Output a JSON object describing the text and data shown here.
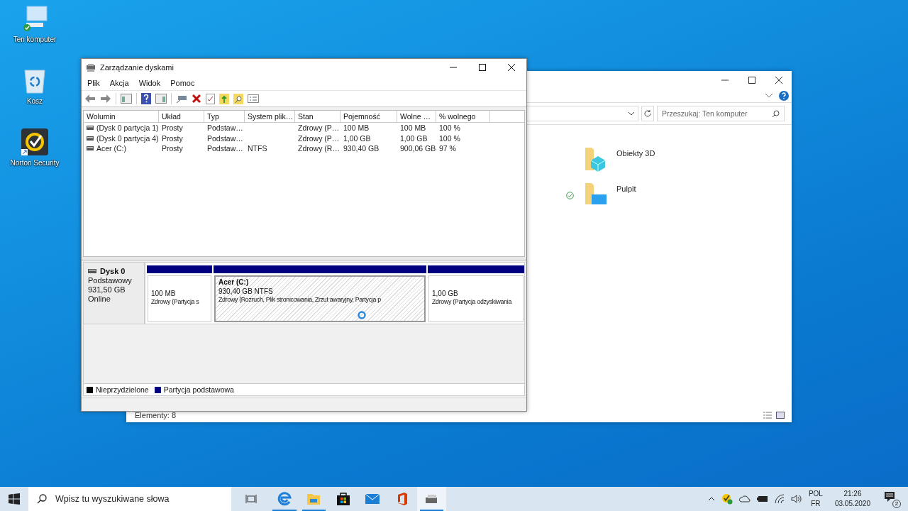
{
  "desktop_icons": [
    {
      "kind": "computer",
      "label": "Ten komputer"
    },
    {
      "kind": "recycle",
      "label": "Kosz"
    },
    {
      "kind": "norton",
      "label": "Norton Security"
    }
  ],
  "explorer": {
    "search": {
      "placeholder": "Przeszukaj: Ten komputer"
    },
    "items": [
      {
        "kind": "objects",
        "label": "Obiekty 3D",
        "synced": false
      },
      {
        "kind": "desktop",
        "label": "Pulpit",
        "synced": true
      }
    ],
    "status_bar": "Elementy: 8"
  },
  "disk_management": {
    "title": "Zarządzanie dyskami",
    "menu": [
      "Plik",
      "Akcja",
      "Widok",
      "Pomoc"
    ],
    "columns": [
      "Wolumin",
      "Układ",
      "Typ",
      "System plik…",
      "Stan",
      "Pojemność",
      "Wolne …",
      "% wolnego"
    ],
    "rows": [
      {
        "cells": [
          "(Dysk 0 partycja 1)",
          "Prosty",
          "Podstaw…",
          "",
          "Zdrowy (P…",
          "100 MB",
          "100 MB",
          "100 %"
        ]
      },
      {
        "cells": [
          "(Dysk 0 partycja 4)",
          "Prosty",
          "Podstaw…",
          "",
          "Zdrowy (P…",
          "1,00 GB",
          "1,00 GB",
          "100 %"
        ]
      },
      {
        "cells": [
          "Acer (C:)",
          "Prosty",
          "Podstaw…",
          "NTFS",
          "Zdrowy (R…",
          "930,40 GB",
          "900,06 GB",
          "97 %"
        ]
      }
    ],
    "disk": {
      "name": "Dysk 0",
      "type": "Podstawowy",
      "size": "931,50 GB",
      "status": "Online"
    },
    "partitions": [
      {
        "size": "100 MB",
        "status": "Zdrowy (Partycja s",
        "selected": false
      },
      {
        "title": "Acer  (C:)",
        "size": "930,40 GB NTFS",
        "status": "Zdrowy (Rozruch, Plik stronicowania, Zrzut awaryjny, Partycja p",
        "selected": true
      },
      {
        "size": "1,00 GB",
        "status": "Zdrowy (Partycja odzyskiwania",
        "selected": false
      }
    ],
    "legend": [
      {
        "label": "Nieprzydzielone",
        "color": "#000000"
      },
      {
        "label": "Partycja podstawowa",
        "color": "#000080"
      }
    ]
  },
  "taskbar": {
    "search": {
      "placeholder": "Wpisz tu wyszukiwane słowa"
    },
    "apps": [
      {
        "kind": "edge",
        "running": true,
        "active": false
      },
      {
        "kind": "folder",
        "running": true,
        "active": false
      },
      {
        "kind": "store",
        "running": false,
        "active": false
      },
      {
        "kind": "mail",
        "running": false,
        "active": false
      },
      {
        "kind": "office",
        "running": false,
        "active": false
      },
      {
        "kind": "disk",
        "running": true,
        "active": true
      }
    ],
    "language": "POL",
    "layout": "FR",
    "time": "21:26",
    "date": "03.05.2020",
    "notifications": "2"
  }
}
